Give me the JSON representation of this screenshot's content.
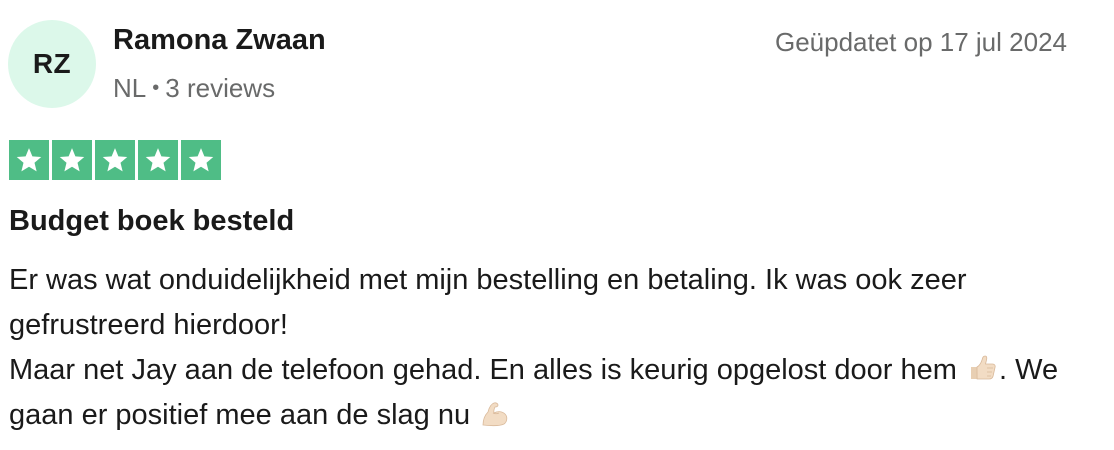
{
  "reviewer": {
    "initials": "RZ",
    "name": "Ramona Zwaan",
    "country": "NL",
    "separator": "•",
    "review_count": "3 reviews"
  },
  "review": {
    "date": "Geüpdatet op 17 jul 2024",
    "rating": 5,
    "star_color": "#4fbd86",
    "title": "Budget boek besteld",
    "line1": "Er was wat onduidelijkheid met mijn bestelling en betaling. Ik was ook zeer gefrustreerd hierdoor!",
    "line2_a": "Maar net Jay aan de telefoon gehad. En alles is keurig opgelost door hem",
    "line2_b": ". We gaan er positief mee aan de slag nu",
    "emoji_1": "thumbs-up-icon",
    "emoji_2": "flexed-biceps-icon"
  },
  "colors": {
    "avatar_bg": "#dcf8ea",
    "meta_text": "#696a6a",
    "body_text": "#1a1a1a"
  }
}
